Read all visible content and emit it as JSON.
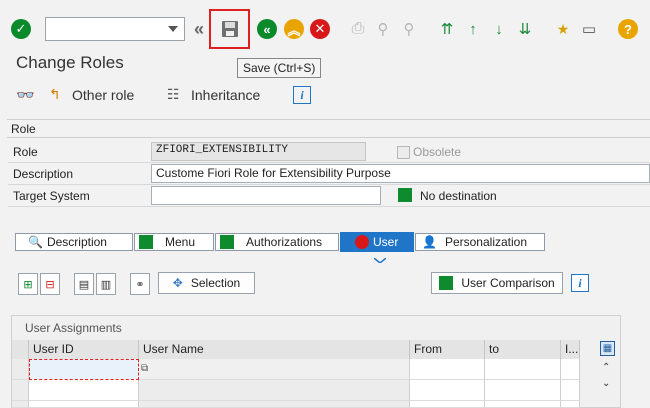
{
  "toolbar": {
    "command_value": "",
    "save_tooltip": "Save  (Ctrl+S)"
  },
  "page": {
    "title": "Change Roles"
  },
  "app_toolbar": {
    "other_role": "Other role",
    "inheritance": "Inheritance"
  },
  "role": {
    "group_label": "Role",
    "role_label": "Role",
    "role_value": "ZFIORI_EXTENSIBILITY",
    "obsolete_label": "Obsolete",
    "description_label": "Description",
    "description_value": "Custome Fiori Role for Extensibility Purpose",
    "target_label": "Target System",
    "target_value": "",
    "no_destination": "No destination"
  },
  "tabs": [
    "Description",
    "Menu",
    "Authorizations",
    "User",
    "Personalization"
  ],
  "user_tab": {
    "selection_button": "Selection",
    "user_comparison_button": "User Comparison",
    "group_label": "User Assignments",
    "columns": [
      "User ID",
      "User Name",
      "From",
      "to",
      "I..."
    ]
  },
  "colors": {
    "ok": "#0a8a2b",
    "accent": "#1f75c7",
    "cancel": "#d81818",
    "exit": "#e9a400",
    "status_green": "#0e8a2f"
  }
}
